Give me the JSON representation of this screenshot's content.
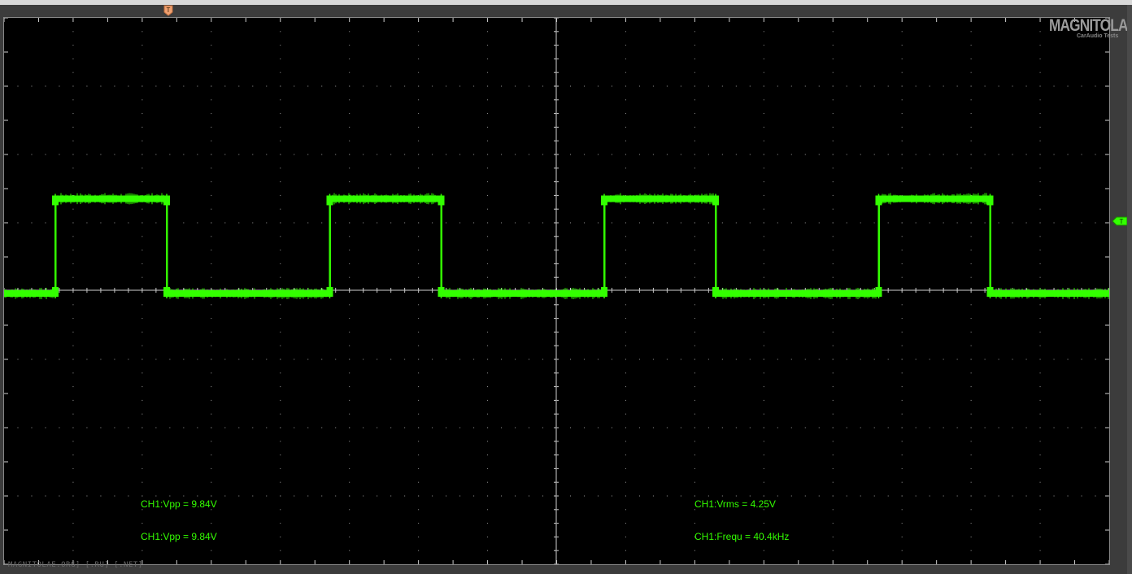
{
  "logo": {
    "brand": "MAGNITOLA",
    "tagline": "CarAudio Tests"
  },
  "trigger": {
    "top_marker": "T",
    "level_marker": "T"
  },
  "measurements": {
    "left_top": "CH1:Vpp = 9.84V",
    "left_bottom": "CH1:Vpp = 9.84V",
    "right_top": "CH1:Vrms = 4.25V",
    "right_bottom": "CH1:Frequ = 40.4kHz"
  },
  "watermark": "MAGNITOLAE.ORG] [.RU] [.NET]",
  "colors": {
    "trace": "#33ff00",
    "screen_bg": "#000000",
    "graticule": "#cfcfcf",
    "trigger_marker_top": "#f0a070",
    "trigger_marker_level": "#33ff00"
  },
  "trace": {
    "waveform": "square",
    "high_level": 0.67,
    "low_level": 0,
    "periods_visible": 4,
    "duty_cycle": 0.4
  }
}
